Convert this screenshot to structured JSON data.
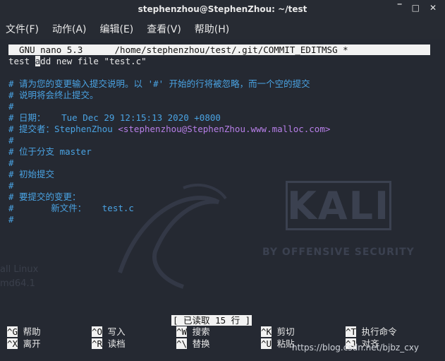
{
  "window": {
    "title": "stephenzhou@StephenZhou: ~/test",
    "controls": {
      "minimize": "‾",
      "maximize": "□",
      "close": "✕"
    }
  },
  "menu": [
    "文件(F)",
    "动作(A)",
    "编辑(E)",
    "查看(V)",
    "帮助(H)"
  ],
  "nano": {
    "header": "  GNU nano 5.3      /home/stephenzhou/test/.git/COMMIT_EDITMSG *  ",
    "line1_pre": "test ",
    "line1_cursor": "a",
    "line1_post": "dd new file \"test.c\"",
    "comments": {
      "c1": "# 请为您的变更输入提交说明。以 '#' 开始的行将被忽略，而一个空的提交",
      "c2": "# 说明将会终止提交。",
      "c3": "#",
      "c4": "# 日期：   Tue Dec 29 12:15:13 2020 +0800",
      "c5_prefix": "# 提交者：StephenZhou ",
      "c5_email": "<stephenzhou@StephenZhou.www.malloc.com>",
      "c6": "#",
      "c7": "# 位于分支 master",
      "c8": "#",
      "c9": "# 初始提交",
      "c10": "#",
      "c11": "# 要提交的变更：",
      "c12": "#       新文件：   test.c",
      "c13": "#"
    },
    "status": "[ 已读取 15 行 ]",
    "shortcuts": {
      "s1_key": "^G",
      "s1_label": " 帮助",
      "s2_key": "^X",
      "s2_label": " 离开",
      "s3_key": "^O",
      "s3_label": " 写入",
      "s4_key": "^R",
      "s4_label": " 读档",
      "s5_key": "^W",
      "s5_label": " 搜索",
      "s6_key": "^\\",
      "s6_label": " 替换",
      "s7_key": "^K",
      "s7_label": " 剪切",
      "s8_key": "^U",
      "s8_label": " 粘贴",
      "s9_key": "^T",
      "s9_label": " 执行命令",
      "s10_key": "^J",
      "s10_label": " 对齐"
    }
  },
  "watermark": {
    "kali": "KALI",
    "kali_sub": "BY OFFENSIVE SECURITY",
    "left1": "all Linux",
    "left2": "md64.1"
  },
  "footer_url": "https://blog.csdn.net/bjbz_cxy",
  "colors": {
    "comment": "#4aa3e3",
    "email": "#b77fe8",
    "background": "#252932"
  }
}
